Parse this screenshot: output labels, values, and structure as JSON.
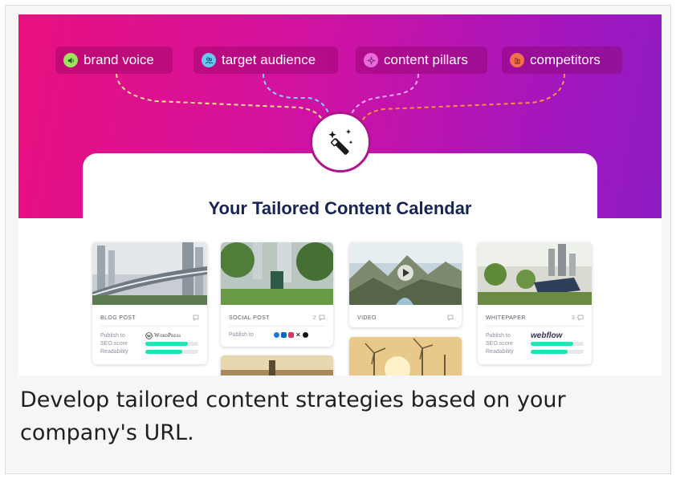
{
  "chips": [
    {
      "label": "brand voice",
      "icon": "speaker-icon",
      "dot_color": "#9ee35e",
      "line_color": "#fde68a"
    },
    {
      "label": "target audience",
      "icon": "people-icon",
      "dot_color": "#67c7ee",
      "line_color": "#7dd3fc"
    },
    {
      "label": "content pillars",
      "icon": "sparkle-icon",
      "dot_color": "#e96bd8",
      "line_color": "#f0abfc"
    },
    {
      "label": "competitors",
      "icon": "building-icon",
      "dot_color": "#f2704e",
      "line_color": "#fb923c"
    }
  ],
  "center_icon": "magic-wand-icon",
  "panel": {
    "title": "Your Tailored Content Calendar"
  },
  "tiles": {
    "blog": {
      "type": "BLOG POST",
      "publish_label": "Publish to",
      "platform": "WordPress",
      "seo_label": "SEO score",
      "readability_label": "Readability",
      "seo_value": 0.8,
      "readability_value": 0.7
    },
    "social": {
      "type": "SOCIAL POST",
      "count": "2",
      "publish_label": "Publish to",
      "networks": [
        "facebook-icon",
        "linkedin-icon",
        "instagram-icon",
        "x-icon",
        "threads-icon"
      ]
    },
    "video": {
      "type": "VIDEO"
    },
    "whitepaper": {
      "type": "WHITEPAPER",
      "count": "3",
      "publish_label": "Publish to",
      "platform": "webflow",
      "seo_label": "SEO score",
      "readability_label": "Readability",
      "seo_value": 0.8,
      "readability_value": 0.7
    }
  },
  "caption": "Develop tailored content strategies based on your company's URL.",
  "colors": {
    "gradient_start": "#e8107e",
    "gradient_end": "#8f1cc4",
    "title": "#172554",
    "bar_fill": "#19e6b4"
  }
}
